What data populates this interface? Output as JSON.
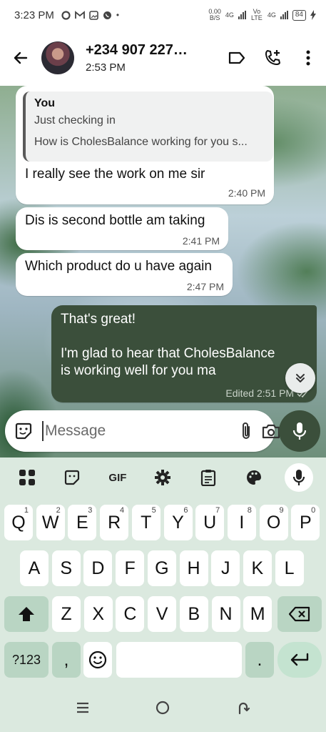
{
  "status_bar": {
    "time": "3:23 PM",
    "net_speed": "0.00",
    "net_unit": "B/S",
    "net1": "4G",
    "net2": "Vo LTE",
    "net3": "4G",
    "battery": "84"
  },
  "header": {
    "contact_name": "+234 907 227…",
    "last_seen": "2:53 PM"
  },
  "messages": [
    {
      "direction": "in",
      "quote_author": "You",
      "quote_line1": "Just checking in",
      "quote_line2": "How is CholesBalance working for you s...",
      "text": "I really see the work on me sir",
      "time": "2:40 PM"
    },
    {
      "direction": "in",
      "text": "Dis is second bottle am taking",
      "time": "2:41 PM"
    },
    {
      "direction": "in",
      "text": "Which product do u have again",
      "time": "2:47 PM"
    },
    {
      "direction": "out",
      "line1": "That's great!",
      "line2": "I'm glad to hear that CholesBalance",
      "line3": "is working well for you ma",
      "time": "Edited 2:51 PM"
    }
  ],
  "composer": {
    "placeholder": "Message"
  },
  "keyboard": {
    "toolbar_gif": "GIF",
    "row1": [
      {
        "k": "Q",
        "h": "1"
      },
      {
        "k": "W",
        "h": "2"
      },
      {
        "k": "E",
        "h": "3"
      },
      {
        "k": "R",
        "h": "4"
      },
      {
        "k": "T",
        "h": "5"
      },
      {
        "k": "Y",
        "h": "6"
      },
      {
        "k": "U",
        "h": "7"
      },
      {
        "k": "I",
        "h": "8"
      },
      {
        "k": "O",
        "h": "9"
      },
      {
        "k": "P",
        "h": "0"
      }
    ],
    "row2": [
      "A",
      "S",
      "D",
      "F",
      "G",
      "H",
      "J",
      "K",
      "L"
    ],
    "row3": [
      "Z",
      "X",
      "C",
      "V",
      "B",
      "N",
      "M"
    ],
    "symbols_label": "?123",
    "comma": ",",
    "period": "."
  },
  "colors": {
    "outgoing_bubble": "#3b4f3b",
    "keyboard_bg": "#dbe9df",
    "accent_key": "#b9d5c3"
  }
}
